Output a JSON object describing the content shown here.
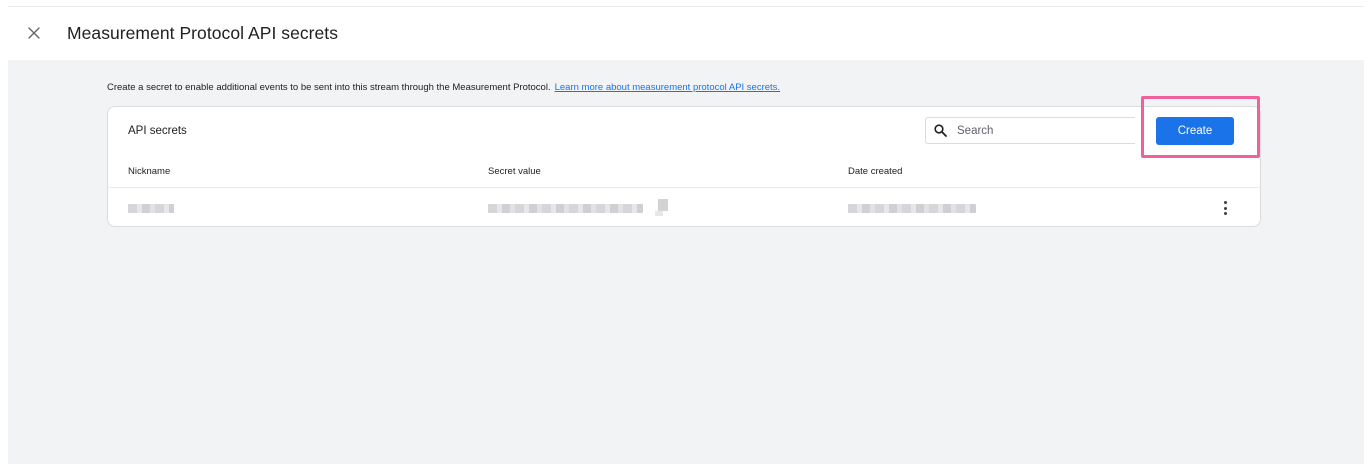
{
  "header": {
    "close_icon": "close-icon",
    "title": "Measurement Protocol API secrets"
  },
  "intro": {
    "text": "Create a secret to enable additional events to be sent into this stream through the Measurement Protocol.",
    "link": "Learn more about measurement protocol API secrets."
  },
  "card": {
    "title": "API secrets",
    "search": {
      "icon": "search-icon",
      "placeholder": "Search",
      "value": ""
    },
    "create_label": "Create",
    "columns": [
      "Nickname",
      "Secret value",
      "Date created"
    ],
    "rows": [
      {
        "nickname": "",
        "secret_value": "",
        "date_created": "",
        "redacted": true,
        "menu_icon": "more-vert-icon"
      }
    ]
  },
  "colors": {
    "accent": "#1a73e8",
    "highlight": "#f0609a",
    "content_bg": "#f1f3f4"
  }
}
